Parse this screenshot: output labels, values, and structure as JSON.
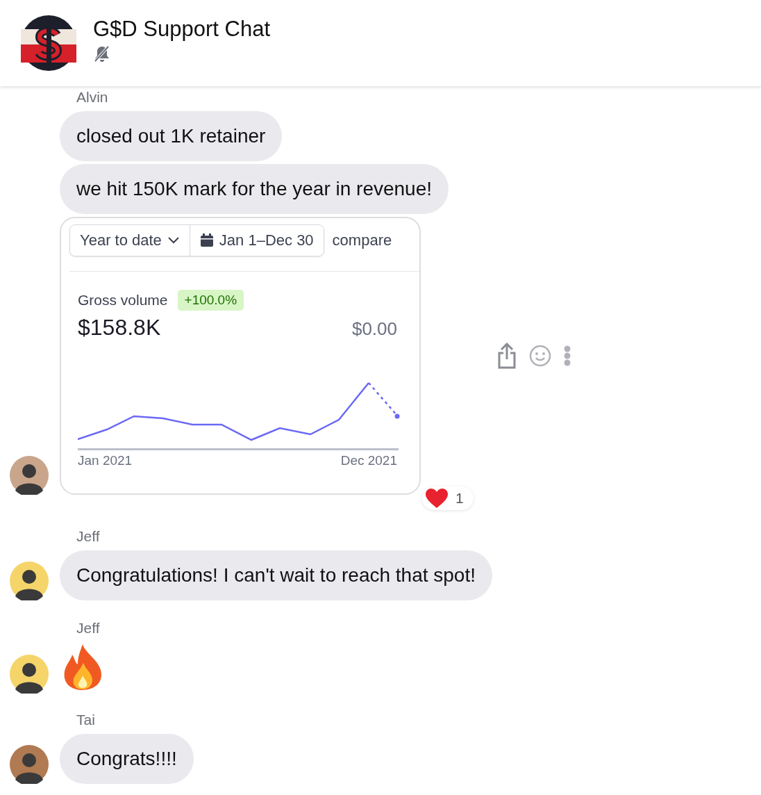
{
  "header": {
    "title": "G$D Support Chat",
    "muted": true
  },
  "groups": [
    {
      "sender": "Alvin",
      "color": "#c9a58c",
      "items": [
        {
          "kind": "text",
          "text": "closed out 1K retainer"
        },
        {
          "kind": "text",
          "text": "we hit 150K mark for the year in revenue!"
        },
        {
          "kind": "card",
          "card": {
            "range": "Year to date",
            "dates": "Jan 1–Dec 30",
            "compare": "compare",
            "metric": "Gross volume",
            "change": "+100.0%",
            "value": "$158.8K",
            "previous": "$0.00",
            "start": "Jan 2021",
            "end": "Dec 2021"
          },
          "reactions": [
            {
              "kind": "heart",
              "count": "1"
            }
          ]
        }
      ]
    },
    {
      "sender": "Jeff",
      "color": "#f5d46a",
      "items": [
        {
          "kind": "text",
          "text": "Congratulations! I can't wait to reach that spot!"
        }
      ]
    },
    {
      "sender": "Jeff",
      "color": "#f5d46a",
      "items": [
        {
          "kind": "fire"
        }
      ]
    },
    {
      "sender": "Tai",
      "color": "#b07a52",
      "items": [
        {
          "kind": "text",
          "text": "Congrats!!!!"
        }
      ]
    }
  ]
}
